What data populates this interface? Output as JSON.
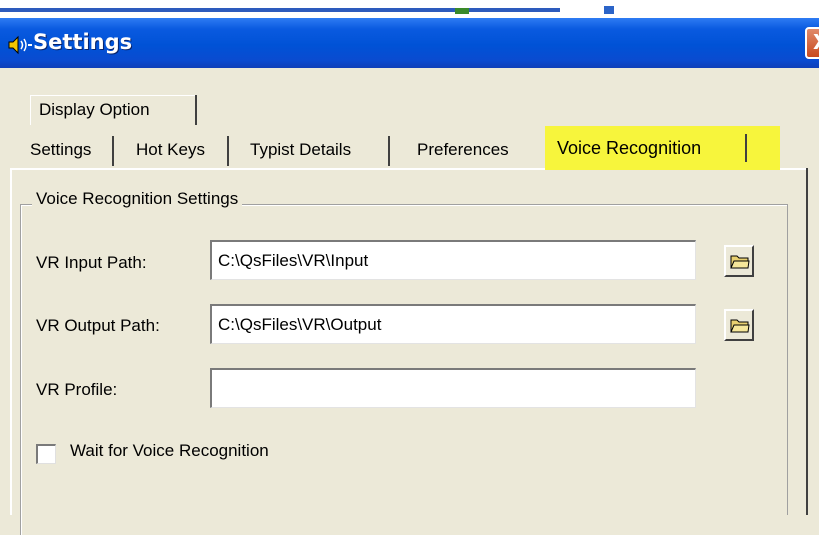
{
  "window": {
    "title": "Settings"
  },
  "tabs": {
    "row1": [
      {
        "label": "Display Option"
      }
    ],
    "row2": [
      {
        "label": "Settings"
      },
      {
        "label": "Hot Keys"
      },
      {
        "label": "Typist Details"
      },
      {
        "label": "Preferences"
      },
      {
        "label": "Voice Recognition",
        "selected": true,
        "highlight_color": "#f7f53c"
      }
    ]
  },
  "voice_recognition": {
    "group_title": "Voice Recognition Settings",
    "input_path": {
      "label": "VR Input Path:",
      "value": "C:\\QsFiles\\VR\\Input"
    },
    "output_path": {
      "label": "VR Output Path:",
      "value": "C:\\QsFiles\\VR\\Output"
    },
    "profile": {
      "label": "VR Profile:",
      "value": ""
    },
    "wait_checkbox": {
      "label": "Wait for Voice Recognition",
      "checked": false
    }
  },
  "icons": {
    "app": "speaker-icon",
    "browse": "folder-icon",
    "close": "close-icon"
  },
  "colors": {
    "titlebar": "#0052d6",
    "dialog_bg": "#ECE9D8",
    "highlight": "#f7f53c"
  }
}
